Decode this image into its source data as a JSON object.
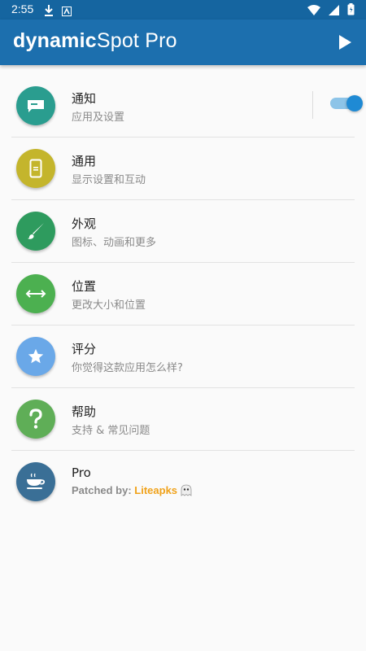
{
  "status_bar": {
    "time": "2:55"
  },
  "app_bar": {
    "title_bold": "dynamic",
    "title_light": "Spot Pro"
  },
  "colors": {
    "app_bar": "#1c6fae",
    "status_bar": "#1565a0",
    "accent": "#1f8ad4",
    "patched_link": "#f0a21a"
  },
  "menu": [
    {
      "title": "通知",
      "subtitle": "应用及设置",
      "icon": "message-icon",
      "color": "#2a9d8f"
    },
    {
      "title": "通用",
      "subtitle": "显示设置和互动",
      "icon": "phone-icon",
      "color": "#c4b52c"
    },
    {
      "title": "外观",
      "subtitle": "图标、动画和更多",
      "icon": "brush-icon",
      "color": "#2e9b5e"
    },
    {
      "title": "位置",
      "subtitle": "更改大小和位置",
      "icon": "arrows-horizontal-icon",
      "color": "#4cb050"
    },
    {
      "title": "评分",
      "subtitle": "你觉得这款应用怎么样?",
      "icon": "star-icon",
      "color": "#6aa8e8"
    },
    {
      "title": "帮助",
      "subtitle": "支持 & 常见问题",
      "icon": "help-icon",
      "color": "#5fae57"
    },
    {
      "title": "Pro",
      "patched_label": "Patched by: ",
      "patched_link": "Liteapks",
      "icon": "coffee-icon",
      "color": "#3a6f96"
    }
  ],
  "notification_toggle": {
    "on": true
  }
}
